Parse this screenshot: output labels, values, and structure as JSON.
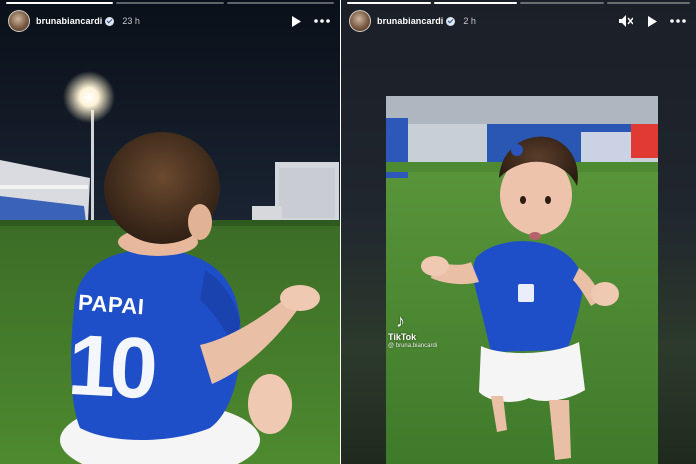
{
  "left_story": {
    "username": "brunabiancardi",
    "timestamp": "23 h",
    "progress_segments": [
      1,
      0,
      0
    ],
    "jersey_name": "PAPAI",
    "jersey_number": "10"
  },
  "right_story": {
    "username": "brunabiancardi",
    "timestamp": "2 h",
    "progress_segments": [
      1,
      1,
      0,
      0
    ],
    "tiktok_label": "TikTok",
    "tiktok_handle": "@ bruna.biancardi"
  },
  "icons": {
    "play": "play-icon",
    "more": "more-icon",
    "mute": "mute-icon",
    "verified": "verified-icon"
  },
  "colors": {
    "jersey_blue": "#1f4fc8",
    "grass": "#3f7a2b",
    "night_sky": "#0d1420"
  }
}
